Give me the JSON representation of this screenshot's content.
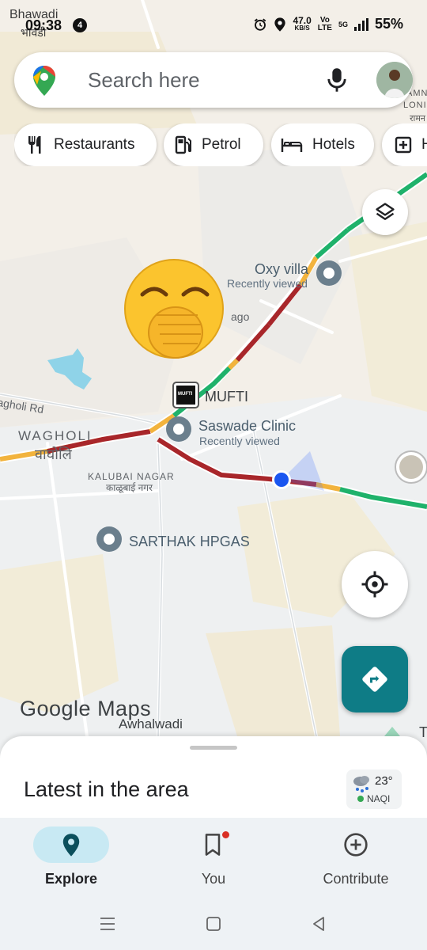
{
  "status_bar": {
    "location_line1": "Bhawadi",
    "location_line2": "भावडी",
    "time": "09:38",
    "notification_count": "4",
    "net_speed_value": "47.0",
    "net_speed_unit": "KB/S",
    "volte_top": "Vo",
    "volte_bottom": "LTE",
    "network": "5G",
    "battery": "55%"
  },
  "search": {
    "placeholder": "Search here"
  },
  "chips": [
    "Restaurants",
    "Petrol",
    "Hotels",
    "H"
  ],
  "map": {
    "edge_labels": [
      "AMN",
      "LONI",
      "रामन"
    ],
    "places": [
      {
        "name": "Oxy villa",
        "sub": "Recently viewed"
      },
      {
        "name": "MUFTI",
        "logo_text": "MUFTI"
      },
      {
        "name": "Saswade Clinic",
        "sub": "Recently viewed"
      },
      {
        "name": "SARTHAK HPGAS"
      }
    ],
    "fragment_label": "ago",
    "road_label": "agholi Rd",
    "areas": {
      "wagholi": "WAGHOLI",
      "wagholi_local": "वाघोलि",
      "kalubai": "KALUBAI NAGAR",
      "kalubai_local": "काळूबाई नगर",
      "awhalwadi": "Awhalwadi"
    },
    "edge_right": "T",
    "attribution": "Google Maps",
    "colors": {
      "traffic_heavy": "#a8262a",
      "traffic_slow": "#f2b33d",
      "traffic_free": "#1fb26b",
      "accent": "#0e7c86",
      "user_location": "#1a56f0"
    }
  },
  "buttons": {
    "layers": "layers-icon",
    "my_location": "my-location-icon",
    "directions": "directions-icon"
  },
  "sheet": {
    "title": "Latest in the area",
    "weather_temp": "23°",
    "air_quality": "NAQI"
  },
  "nav": {
    "items": [
      {
        "label": "Explore",
        "icon": "pin-icon",
        "active": true
      },
      {
        "label": "You",
        "icon": "bookmark-icon",
        "active": false
      },
      {
        "label": "Contribute",
        "icon": "add-circle-icon",
        "active": false
      }
    ]
  },
  "system_nav": [
    "menu-icon",
    "home-icon",
    "back-icon"
  ]
}
